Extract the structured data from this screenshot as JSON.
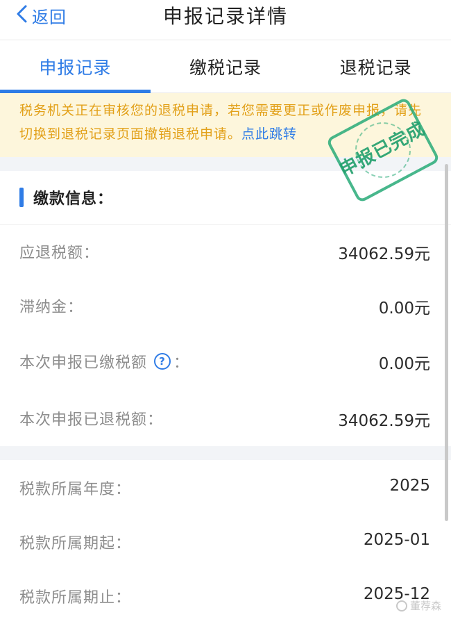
{
  "nav": {
    "back_label": "返回",
    "title": "申报记录详情"
  },
  "tabs": [
    {
      "label": "申报记录",
      "active": true
    },
    {
      "label": "缴税记录",
      "active": false
    },
    {
      "label": "退税记录",
      "active": false
    }
  ],
  "notice": {
    "text": "税务机关正在审核您的退税申请，若您需要更正或作废申报，请先切换到退税记录页面撤销退税申请。",
    "link_text": "点此跳转"
  },
  "stamp": {
    "text": "申报已完成"
  },
  "payment_section": {
    "title": "缴款信息：",
    "rows": [
      {
        "label": "应退税额：",
        "value": "34062.59元"
      },
      {
        "label": "滞纳金：",
        "value": "0.00元"
      },
      {
        "label": "本次申报已缴税额",
        "suffix": "：",
        "value": "0.00元",
        "help": "?"
      },
      {
        "label": "本次申报已退税额：",
        "value": "34062.59元"
      }
    ]
  },
  "period_section": {
    "rows": [
      {
        "label": "税款所属年度：",
        "value": "2025"
      },
      {
        "label": "税款所属期起：",
        "value": "2025-01"
      },
      {
        "label": "税款所属期止：",
        "value": "2025-12"
      }
    ]
  },
  "watermark": {
    "text": "董荐森"
  },
  "colors": {
    "accent": "#2f7ce6",
    "notice_text": "#e2a018",
    "notice_bg": "#fdf6dc",
    "stamp": "#28aa78"
  }
}
